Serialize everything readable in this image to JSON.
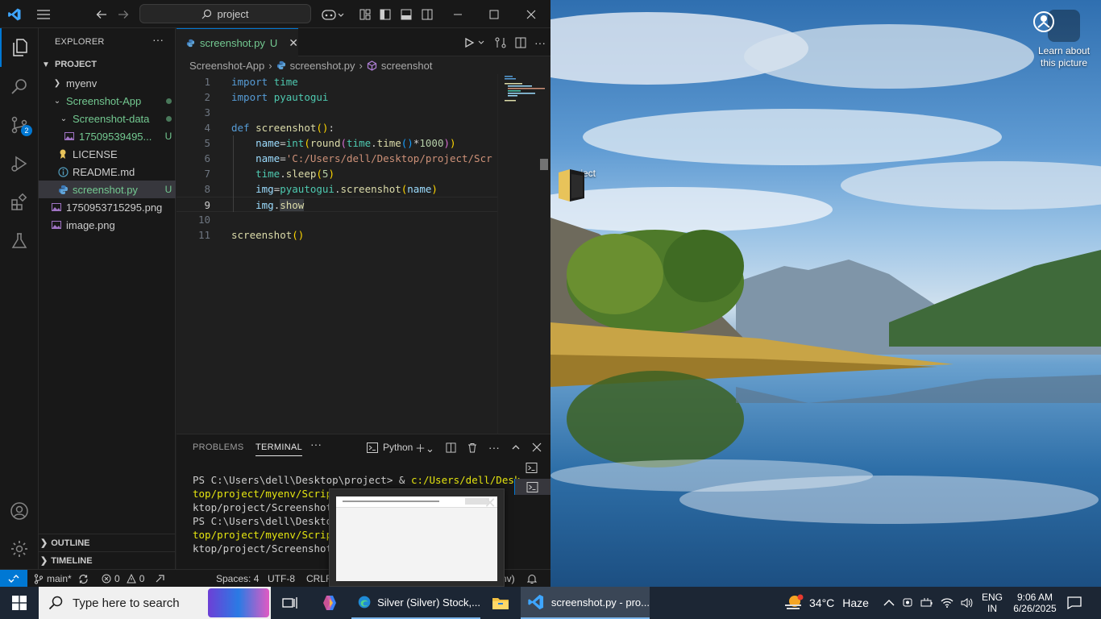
{
  "titlebar": {
    "search_text": "project"
  },
  "explorer": {
    "title": "EXPLORER",
    "root": "PROJECT",
    "items": [
      {
        "label": "myenv",
        "decoration": ""
      },
      {
        "label": "Screenshot-App",
        "decoration": ""
      },
      {
        "label": "Screenshot-data",
        "decoration": ""
      },
      {
        "label": "17509539495...",
        "decoration": "U"
      },
      {
        "label": "LICENSE",
        "decoration": ""
      },
      {
        "label": "README.md",
        "decoration": ""
      },
      {
        "label": "screenshot.py",
        "decoration": "U"
      },
      {
        "label": "1750953715295.png",
        "decoration": ""
      },
      {
        "label": "image.png",
        "decoration": ""
      }
    ],
    "outline": "OUTLINE",
    "timeline": "TIMELINE"
  },
  "activity": {
    "scm_badge": "2"
  },
  "tab": {
    "label": "screenshot.py",
    "status": "U"
  },
  "breadcrumb": {
    "folder": "Screenshot-App",
    "file": "screenshot.py",
    "symbol": "screenshot"
  },
  "editor": {
    "line_numbers": [
      "1",
      "2",
      "3",
      "4",
      "5",
      "6",
      "7",
      "8",
      "9",
      "10",
      "11"
    ],
    "current_line": 9,
    "path_string": "'C:/Users/dell/Desktop/project/Scr"
  },
  "panel": {
    "tabs": [
      "PROBLEMS",
      "TERMINAL"
    ],
    "active_tab": "TERMINAL",
    "shell": "Python",
    "terminal": {
      "l1_prompt": "PS C:\\Users\\dell\\Desktop\\project> & ",
      "l1_cmd": "c:/Users/dell/Desk",
      "l2": "top/project/myenv/Script",
      "l3": "ktop/project/Screenshot-",
      "l4": "PS C:\\Users\\dell\\Desktop",
      "l5": "top/project/myenv/Script",
      "l6": "ktop/project/Screenshot-"
    }
  },
  "statusbar": {
    "branch": "main*",
    "errors": "0",
    "warnings": "0",
    "spaces": "Spaces: 4",
    "encoding": "UTF-8",
    "eol": "CRLF",
    "env_tail": "nv)"
  },
  "desktop": {
    "learn_line1": "Learn about",
    "learn_line2": "this picture",
    "folder_label": "project"
  },
  "taskbar": {
    "search_placeholder": "Type here to search",
    "edge_title": "Silver (Silver) Stock,...",
    "vscode_title": "screenshot.py - pro...",
    "weather_temp": "34°C",
    "weather_text": "Haze",
    "lang1": "ENG",
    "lang2": "IN",
    "time": "9:06 AM",
    "date": "6/26/2025"
  },
  "colors": {
    "accent": "#0078d4",
    "untracked": "#73c991",
    "keyword": "#569cd6",
    "function": "#dcdcaa",
    "string": "#ce9178",
    "variable": "#9cdcfe",
    "number": "#b5cea8"
  }
}
